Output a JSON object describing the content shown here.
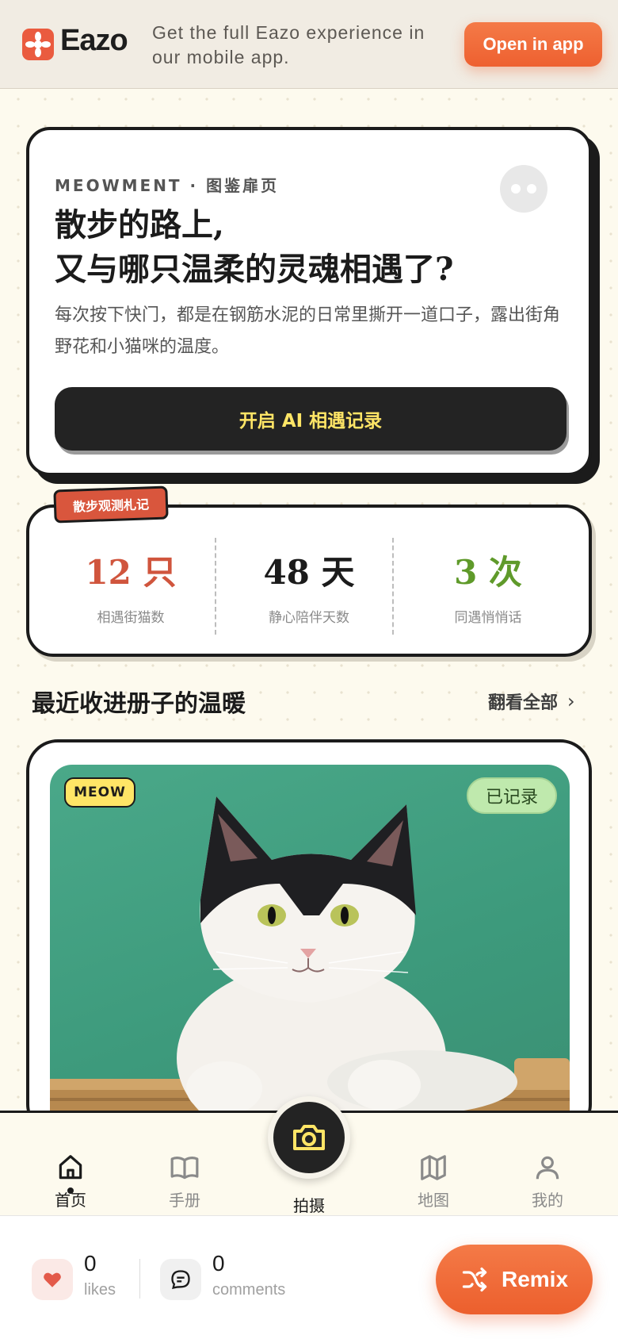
{
  "banner": {
    "logo_text": "Eazo",
    "message": "Get the full Eazo experience in our mobile app.",
    "open_button": "Open in app"
  },
  "hero": {
    "eyebrow": "MEOWMENT · 图鉴扉页",
    "title_line1": "散步的路上,",
    "title_line2": "又与哪只温柔的灵魂相遇了?",
    "description": "每次按下快门，都是在钢筋水泥的日常里撕开一道口子，露出街角野花和小猫咪的温度。",
    "cta": "开启 AI 相遇记录"
  },
  "stats": {
    "tag": "散步观测札记",
    "items": [
      {
        "value": "12 只",
        "label": "相遇街猫数",
        "color": "#d0553d"
      },
      {
        "value": "48 天",
        "label": "静心陪伴天数",
        "color": "#1b1b1b"
      },
      {
        "value": "3 次",
        "label": "同遇悄悄话",
        "color": "#5f9a2a"
      }
    ]
  },
  "recent": {
    "title": "最近收进册子的温暖",
    "see_all": "翻看全部",
    "card": {
      "badge": "MEOW",
      "status": "已记录"
    }
  },
  "tabbar": {
    "home": "首页",
    "handbook": "手册",
    "capture": "拍摄",
    "map": "地图",
    "me": "我的"
  },
  "footer": {
    "likes_count": "0",
    "likes_label": "likes",
    "comments_count": "0",
    "comments_label": "comments",
    "remix": "Remix"
  },
  "colors": {
    "accent": "#ee6030",
    "brand": "#ea5b3f",
    "ink": "#1b1b1b",
    "highlight": "#ffe566"
  }
}
